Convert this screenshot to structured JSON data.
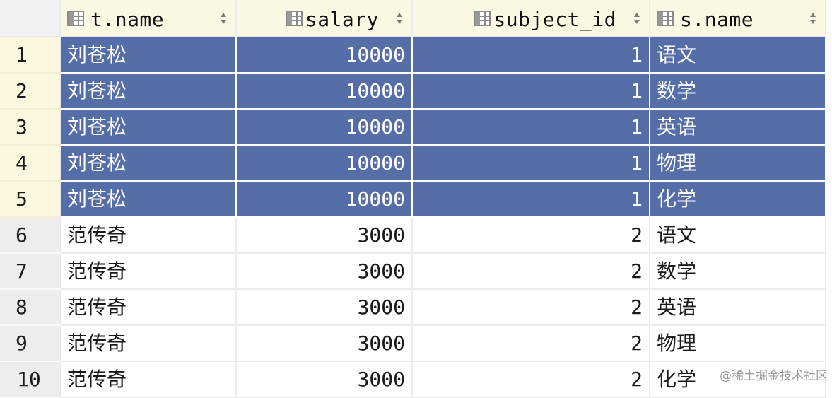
{
  "columns": [
    {
      "key": "t_name",
      "label": "t.name",
      "align": "left"
    },
    {
      "key": "salary",
      "label": "salary",
      "align": "right"
    },
    {
      "key": "subject_id",
      "label": "subject_id",
      "align": "right"
    },
    {
      "key": "s_name",
      "label": "s.name",
      "align": "left"
    }
  ],
  "icons": {
    "column": "table-column-icon",
    "sort": "sort-arrows-icon"
  },
  "colors": {
    "selection": "#566ea8",
    "header_bg": "#fbf8e3",
    "gutter_bg": "#ededed"
  },
  "rows": [
    {
      "num": "1",
      "selected": true,
      "cells": [
        "刘苍松",
        "10000",
        "1",
        "语文"
      ]
    },
    {
      "num": "2",
      "selected": true,
      "cells": [
        "刘苍松",
        "10000",
        "1",
        "数学"
      ]
    },
    {
      "num": "3",
      "selected": true,
      "cells": [
        "刘苍松",
        "10000",
        "1",
        "英语"
      ]
    },
    {
      "num": "4",
      "selected": true,
      "cells": [
        "刘苍松",
        "10000",
        "1",
        "物理"
      ]
    },
    {
      "num": "5",
      "selected": true,
      "cells": [
        "刘苍松",
        "10000",
        "1",
        "化学"
      ]
    },
    {
      "num": "6",
      "selected": false,
      "cells": [
        "范传奇",
        "3000",
        "2",
        "语文"
      ]
    },
    {
      "num": "7",
      "selected": false,
      "cells": [
        "范传奇",
        "3000",
        "2",
        "数学"
      ]
    },
    {
      "num": "8",
      "selected": false,
      "cells": [
        "范传奇",
        "3000",
        "2",
        "英语"
      ]
    },
    {
      "num": "9",
      "selected": false,
      "cells": [
        "范传奇",
        "3000",
        "2",
        "物理"
      ]
    },
    {
      "num": "10",
      "selected": false,
      "cells": [
        "范传奇",
        "3000",
        "2",
        "化学"
      ]
    }
  ],
  "watermark": "@稀土掘金技术社区"
}
